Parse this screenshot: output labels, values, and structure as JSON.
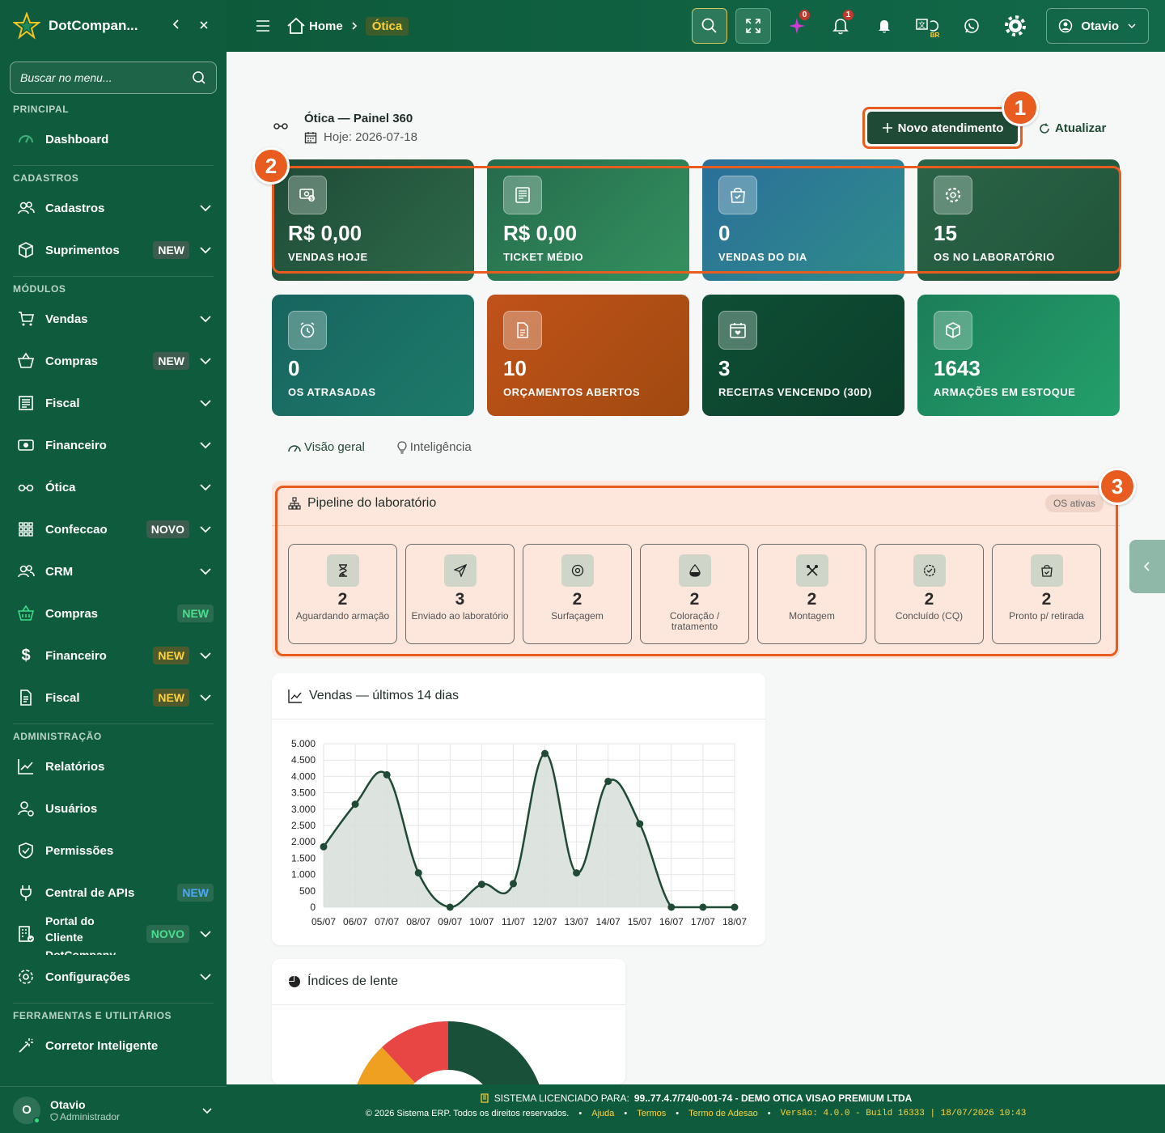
{
  "sidebar": {
    "brand": "DotCompan...",
    "search_placeholder": "Buscar no menu...",
    "sections": {
      "principal": "PRINCIPAL",
      "cadastros": "CADASTROS",
      "modulos": "MÓDULOS",
      "administracao": "ADMINISTRAÇÃO",
      "ferramentas": "FERRAMENTAS E UTILITÁRIOS"
    },
    "items": {
      "dashboard": "Dashboard",
      "cadastros": "Cadastros",
      "suprimentos": "Suprimentos",
      "vendas": "Vendas",
      "compras": "Compras",
      "fiscal": "Fiscal",
      "financeiro": "Financeiro",
      "otica": "Ótica",
      "confeccao": "Confeccao",
      "crm": "CRM",
      "compras2": "Compras",
      "financeiro2": "Financeiro",
      "fiscal2": "Fiscal",
      "relatorios": "Relatórios",
      "usuarios": "Usuários",
      "permissoes": "Permissões",
      "central_apis": "Central de APIs",
      "portal_l1": "Portal do",
      "portal_l2": "Cliente",
      "portal_l3": "DotCompany",
      "configuracoes": "Configurações",
      "corretor": "Corretor Inteligente"
    },
    "badges": {
      "new": "NEW",
      "novo": "NOVO"
    },
    "user": {
      "initial": "O",
      "name": "Otavio",
      "role": "Administrador"
    }
  },
  "topbar": {
    "home": "Home",
    "current": "Ótica",
    "badge_ai": "0",
    "badge_notif": "1",
    "lang": "BR",
    "user": "Otavio"
  },
  "page": {
    "title": "Ótica — Painel 360",
    "date": "Hoje: 2026-07-18",
    "new_button": "Novo atendimento",
    "refresh": "Atualizar"
  },
  "callouts": [
    "1",
    "2",
    "3"
  ],
  "cards": [
    {
      "value": "R$ 0,00",
      "label": "VENDAS HOJE",
      "icon": "money-icon",
      "color": "#23553f"
    },
    {
      "value": "R$ 0,00",
      "label": "TICKET MÉDIO",
      "icon": "receipt-icon",
      "color": "#2b7c56"
    },
    {
      "value": "0",
      "label": "VENDAS DO DIA",
      "icon": "bag-icon",
      "color": "#2a7fa0"
    },
    {
      "value": "15",
      "label": "OS NO LABORATÓRIO",
      "icon": "gear-icon",
      "color": "#2a6448"
    },
    {
      "value": "0",
      "label": "OS ATRASADAS",
      "icon": "alarm-icon",
      "color": "#1b7067"
    },
    {
      "value": "10",
      "label": "ORÇAMENTOS ABERTOS",
      "icon": "document-icon",
      "color": "#b55214"
    },
    {
      "value": "3",
      "label": "RECEITAS VENCENDO (30D)",
      "icon": "calendar-heart-icon",
      "color": "#0f4a33"
    },
    {
      "value": "1643",
      "label": "ARMAÇÕES EM ESTOQUE",
      "icon": "box-icon",
      "color": "#1f8a5f"
    }
  ],
  "tabs": {
    "overview": "Visão geral",
    "intel": "Inteligência"
  },
  "pipeline": {
    "title": "Pipeline do laboratório",
    "tag": "OS ativas",
    "stages": [
      {
        "value": "2",
        "label": "Aguardando armação",
        "icon": "hourglass-icon"
      },
      {
        "value": "3",
        "label": "Enviado ao laboratório",
        "icon": "send-icon"
      },
      {
        "value": "2",
        "label": "Surfaçagem",
        "icon": "disc-icon"
      },
      {
        "value": "2",
        "label": "Coloração / tratamento",
        "icon": "drop-icon"
      },
      {
        "value": "2",
        "label": "Montagem",
        "icon": "tools-icon"
      },
      {
        "value": "2",
        "label": "Concluído (CQ)",
        "icon": "check-badge-icon"
      },
      {
        "value": "2",
        "label": "Pronto p/ retirada",
        "icon": "bag-check-icon"
      }
    ]
  },
  "sales_panel": {
    "title": "Vendas — últimos 14 dias"
  },
  "lens_panel": {
    "title": "Índices de lente"
  },
  "chart_data": {
    "type": "area",
    "title": "Vendas — últimos 14 dias",
    "categories": [
      "05/07",
      "06/07",
      "07/07",
      "08/07",
      "09/07",
      "10/07",
      "11/07",
      "12/07",
      "13/07",
      "14/07",
      "15/07",
      "16/07",
      "17/07",
      "18/07"
    ],
    "series": [
      {
        "values": [
          1850,
          3150,
          4050,
          1050,
          0,
          700,
          720,
          4700,
          1050,
          3850,
          2550,
          0,
          0,
          0
        ]
      }
    ],
    "ylim": [
      0,
      5000
    ],
    "yticks": [
      "0",
      "500",
      "1.000",
      "1.500",
      "2.000",
      "2.500",
      "3.000",
      "3.500",
      "4.000",
      "4.500",
      "5.000"
    ],
    "grid": true,
    "color": "#1f4a36",
    "fill": "#d7dfdb"
  },
  "footer": {
    "license_label": "SISTEMA LICENCIADO PARA:",
    "license_value": "99..77.4.7/74/0-001-74 - DEMO OTICA VISAO PREMIUM LTDA",
    "copyright": "© 2026 Sistema ERP. Todos os direitos reservados.",
    "help": "Ajuda",
    "terms": "Termos",
    "adhesion": "Termo de Adesao",
    "version": "Versão: 4.0.0 - Build 16333 | 18/07/2026 10:43"
  }
}
